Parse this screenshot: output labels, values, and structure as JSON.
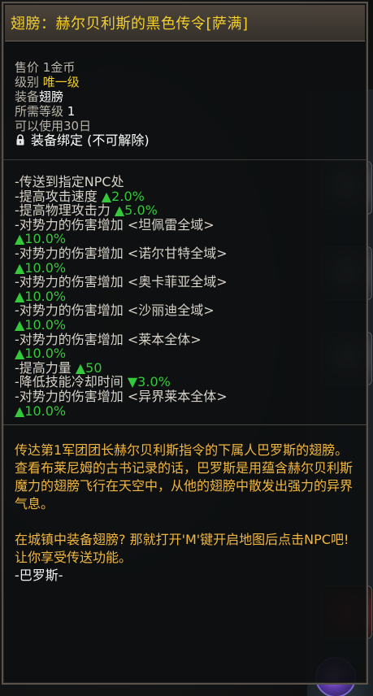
{
  "title": "翅膀：赫尔贝利斯的黑色传令[萨满]",
  "info": {
    "price_label": "售价",
    "price_value": "1金币",
    "grade_label": "级别",
    "grade_value": "唯一级",
    "equip_label": "装备",
    "equip_value": "翅膀",
    "level_label": "所需等级",
    "level_value": "1",
    "duration": "可以使用30日",
    "bound": "装备绑定 (不可解除)"
  },
  "stats": [
    {
      "text": "-传送到指定NPC处",
      "value": ""
    },
    {
      "text": "-提高攻击速度 ",
      "value": "▲2.0%"
    },
    {
      "text": "-提高物理攻击力 ",
      "value": "▲5.0%"
    },
    {
      "text": "-对势力的伤害增加 <坦佩雷全域>",
      "value": ""
    },
    {
      "text": "",
      "value": "▲10.0%"
    },
    {
      "text": "-对势力的伤害增加 <诺尔甘特全域>",
      "value": ""
    },
    {
      "text": "",
      "value": "▲10.0%"
    },
    {
      "text": "-对势力的伤害增加 <奥卡菲亚全域>",
      "value": ""
    },
    {
      "text": "",
      "value": "▲10.0%"
    },
    {
      "text": "-对势力的伤害增加 <沙丽迪全域>",
      "value": ""
    },
    {
      "text": "",
      "value": "▲10.0%"
    },
    {
      "text": "-对势力的伤害增加 <莱本全体>",
      "value": ""
    },
    {
      "text": "",
      "value": "▲10.0%"
    },
    {
      "text": "-提高力量 ",
      "value": "▲50"
    },
    {
      "text": "-降低技能冷却时间 ",
      "value": "▼3.0%"
    },
    {
      "text": "-对势力的伤害增加 <异界莱本全体>",
      "value": ""
    },
    {
      "text": "",
      "value": "▲10.0%"
    }
  ],
  "description": {
    "paragraph1": "传达第1军团团长赫尔贝利斯指令的下属人巴罗斯的翅膀。查看布莱尼姆的古书记录的话，巴罗斯是用蕴含赫尔贝利斯魔力的翅膀飞行在天空中，从他的翅膀中散发出强力的异界气息。",
    "paragraph2": "在城镇中装备翅膀? 那就打开'M'键开启地图后点击NPC吧! 让你享受传送功能。",
    "signature": "-巴罗斯-"
  },
  "colors": {
    "title": "#f2cf2a",
    "stat_green": "#34c93a",
    "description": "#f2b73f"
  },
  "icons": {
    "bound": "lock-icon"
  }
}
